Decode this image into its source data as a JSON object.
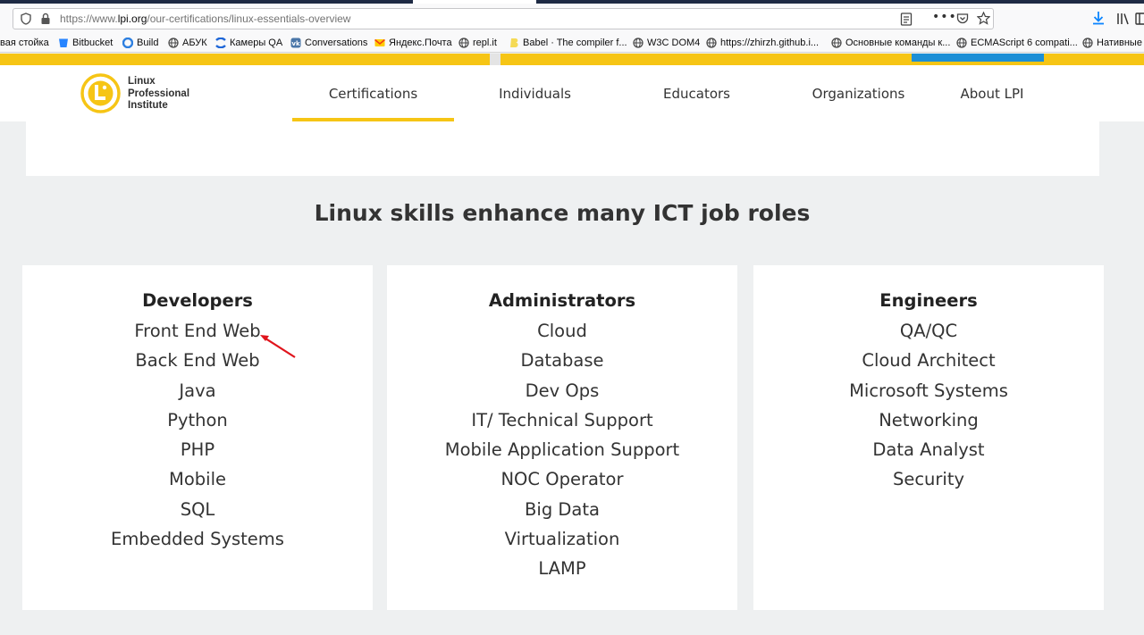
{
  "browser": {
    "url_prefix": "https://www.",
    "url_domain": "lpi.org",
    "url_path": "/our-certifications/linux-essentials-overview",
    "bookmarks": [
      {
        "label": "вая стойка",
        "icon": "bookmark-icon",
        "color": "#8c8c8c"
      },
      {
        "label": "Bitbucket",
        "icon": "bitbucket-icon",
        "color": "#2684ff"
      },
      {
        "label": "Build",
        "icon": "build-icon",
        "color": "#2d7fe0"
      },
      {
        "label": "АБУК",
        "icon": "globe-icon",
        "color": "#444444"
      },
      {
        "label": "Камеры QA",
        "icon": "confluence-icon",
        "color": "#1f67d8"
      },
      {
        "label": "Conversations",
        "icon": "vk-icon",
        "color": "#4a76a8"
      },
      {
        "label": "Яндекс.Почта",
        "icon": "mail-icon",
        "color": "#f23b16"
      },
      {
        "label": "repl.it",
        "icon": "globe-icon",
        "color": "#444444"
      },
      {
        "label": "Babel · The compiler f...",
        "icon": "babel-icon",
        "color": "#f5da55"
      },
      {
        "label": "W3C DOM4",
        "icon": "globe-icon",
        "color": "#444444"
      },
      {
        "label": "https://zhirzh.github.i...",
        "icon": "globe-icon",
        "color": "#444444"
      },
      {
        "label": "Основные команды к...",
        "icon": "globe-icon",
        "color": "#444444"
      },
      {
        "label": "ECMAScript 6 compati...",
        "icon": "globe-icon",
        "color": "#444444"
      },
      {
        "label": "Нативные",
        "icon": "globe-icon",
        "color": "#444444"
      }
    ]
  },
  "site": {
    "logo_lines": [
      "Linux",
      "Professional",
      "Institute"
    ],
    "nav": [
      {
        "label": "Certifications",
        "active": true
      },
      {
        "label": "Individuals",
        "active": false
      },
      {
        "label": "Educators",
        "active": false
      },
      {
        "label": "Organizations",
        "active": false
      },
      {
        "label": "About LPI",
        "active": false
      }
    ],
    "accent_color": "#f6c515"
  },
  "content": {
    "section_title": "Linux skills enhance many ICT job roles",
    "cards": [
      {
        "title": "Developers",
        "items": [
          "Front End Web",
          "Back End Web",
          "Java",
          "Python",
          "PHP",
          "Mobile",
          "SQL",
          "Embedded Systems"
        ]
      },
      {
        "title": "Administrators",
        "items": [
          "Cloud",
          "Database",
          "Dev Ops",
          "IT/ Technical Support",
          "Mobile Application Support",
          "NOC Operator",
          "Big Data",
          "Virtualization",
          "LAMP"
        ]
      },
      {
        "title": "Engineers",
        "items": [
          "QA/QC",
          "Cloud Architect",
          "Microsoft Systems",
          "Networking",
          "Data Analyst",
          "Security"
        ]
      }
    ],
    "annotation_arrow_color": "#e0141c"
  }
}
